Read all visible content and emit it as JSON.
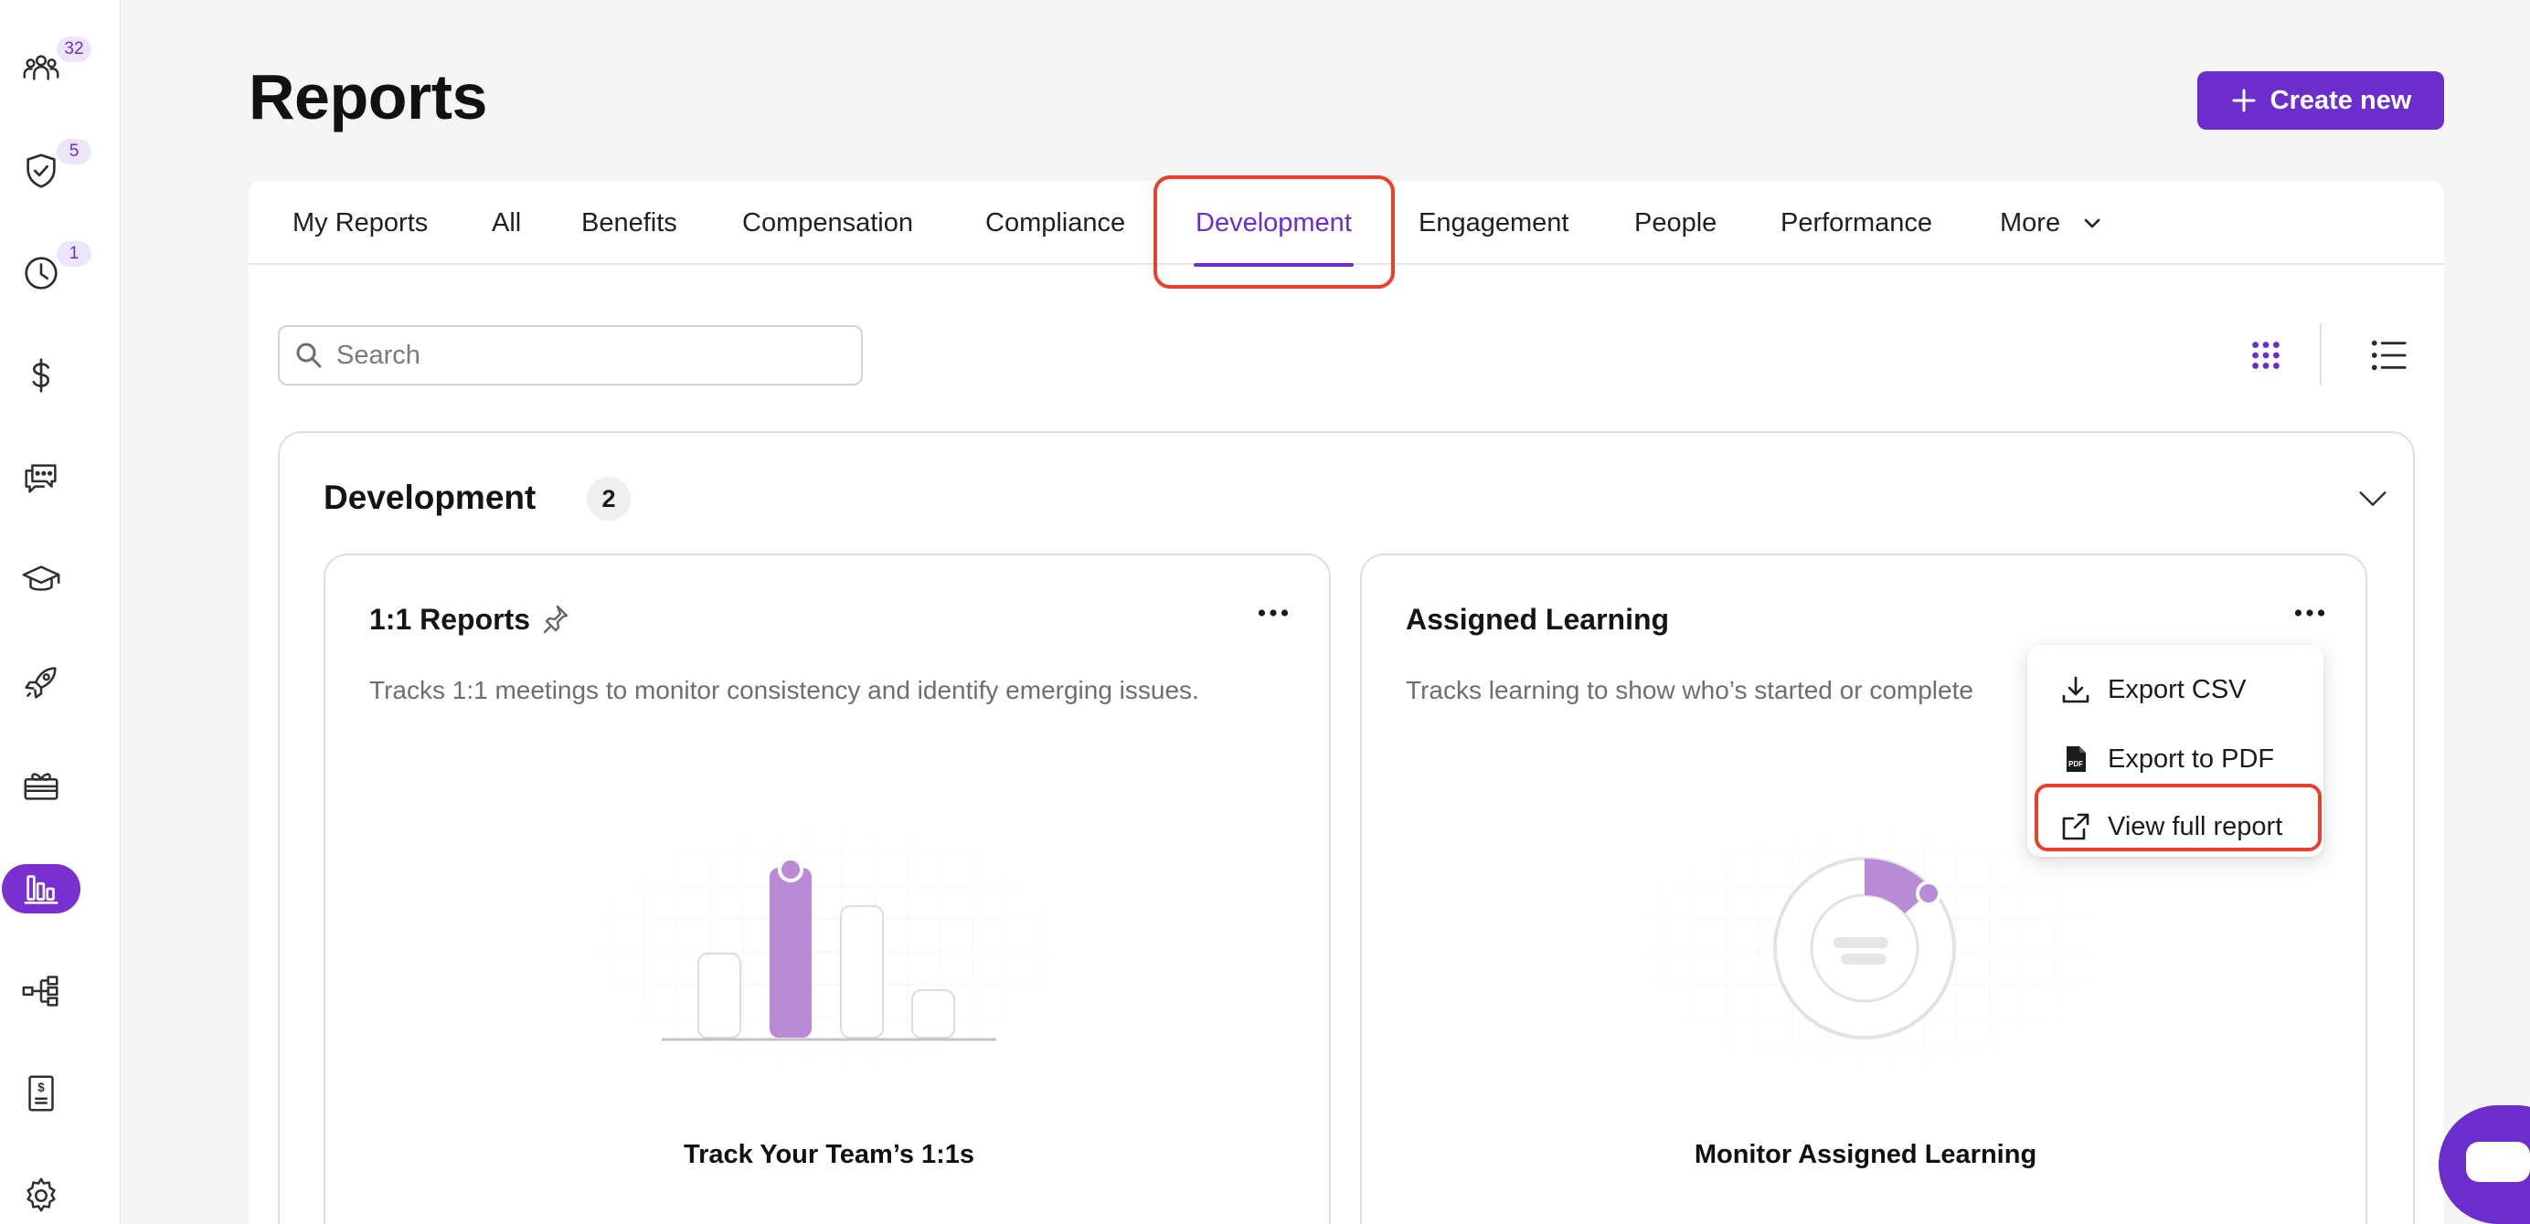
{
  "sidebar": {
    "items": [
      {
        "icon": "people-icon",
        "badge": "32"
      },
      {
        "icon": "shield-check-icon",
        "badge": "5"
      },
      {
        "icon": "clock-icon",
        "badge": "1"
      },
      {
        "icon": "dollar-icon",
        "badge": ""
      },
      {
        "icon": "chat-bubbles-icon",
        "badge": ""
      },
      {
        "icon": "graduation-cap-icon",
        "badge": ""
      },
      {
        "icon": "rocket-icon",
        "badge": ""
      },
      {
        "icon": "gift-icon",
        "badge": ""
      },
      {
        "icon": "bar-chart-icon",
        "badge": "",
        "active": true
      },
      {
        "icon": "org-chart-icon",
        "badge": ""
      },
      {
        "icon": "receipt-icon",
        "badge": ""
      },
      {
        "icon": "gear-icon",
        "badge": ""
      }
    ]
  },
  "header": {
    "title": "Reports",
    "create_label": "Create new"
  },
  "tabs": [
    {
      "label": "My Reports"
    },
    {
      "label": "All"
    },
    {
      "label": "Benefits"
    },
    {
      "label": "Compensation"
    },
    {
      "label": "Compliance"
    },
    {
      "label": "Development",
      "active": true
    },
    {
      "label": "Engagement"
    },
    {
      "label": "People"
    },
    {
      "label": "Performance"
    },
    {
      "label": "More"
    }
  ],
  "search": {
    "placeholder": "Search",
    "value": ""
  },
  "group": {
    "title": "Development",
    "count": "2"
  },
  "cards": [
    {
      "title": "1:1 Reports",
      "description": "Tracks 1:1 meetings to monitor consistency and identify emerging issues.",
      "caption": "Track Your Team’s 1:1s"
    },
    {
      "title": "Assigned Learning",
      "description": "Tracks learning to show who’s started or complete",
      "caption": "Monitor Assigned Learning"
    }
  ],
  "menu": {
    "items": [
      {
        "label": "Export CSV",
        "icon": "download-icon"
      },
      {
        "label": "Export to PDF",
        "icon": "pdf-icon"
      },
      {
        "label": "View full report",
        "icon": "external-link-icon"
      }
    ]
  },
  "colors": {
    "accent": "#6b2ecc",
    "highlight": "#e8402c",
    "illustration": "#b98ad6"
  }
}
